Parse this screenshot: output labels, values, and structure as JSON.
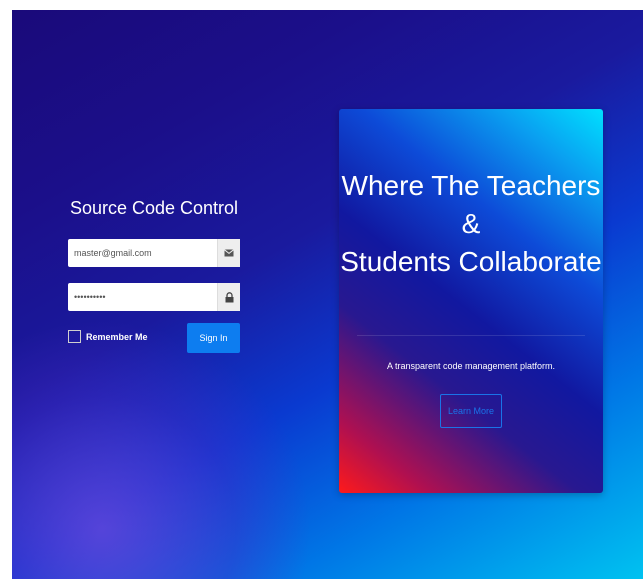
{
  "login": {
    "title": "Source Code Control",
    "email_value": "master@gmail.com",
    "password_value": "••••••••••",
    "remember_label": "Remember Me",
    "signin_label": "Sign In"
  },
  "hero": {
    "line1": "Where The Teachers",
    "line2": "&",
    "line3": "Students Collaborate",
    "tagline": "A transparent code management platform.",
    "learn_more": "Learn More"
  },
  "colors": {
    "signin_button": "#0d7df0",
    "learn_more_border": "#1a73e8",
    "background_start": "#1a0a7a",
    "background_end": "#00c2f0"
  },
  "icons": {
    "email_addon": "envelope-icon",
    "password_addon": "lock-icon"
  }
}
